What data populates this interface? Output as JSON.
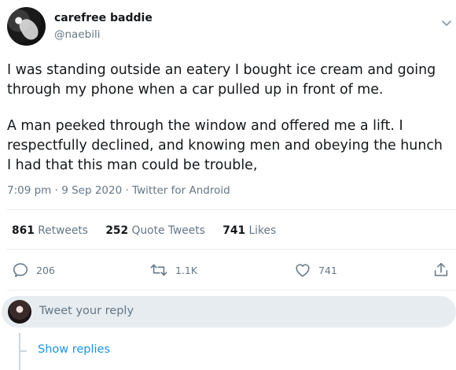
{
  "author": {
    "display_name": "carefree baddie",
    "handle": "@naebili"
  },
  "tweet": {
    "paragraphs": [
      "I was standing outside an eatery I bought ice cream and going through my phone when a car pulled up in front of me.",
      "A man peeked through the window and offered me a lift. I respectfully declined, and knowing men and obeying the hunch I had that this man could be trouble,"
    ],
    "time": "7:09 pm",
    "date": "9 Sep 2020",
    "source": "Twitter for Android",
    "separator": "·"
  },
  "stats": {
    "retweets_count": "861",
    "retweets_label": "Retweets",
    "quotes_count": "252",
    "quotes_label": "Quote Tweets",
    "likes_count": "741",
    "likes_label": "Likes"
  },
  "actions": {
    "reply_count": "206",
    "retweet_count": "1.1K",
    "like_count": "741"
  },
  "reply_box": {
    "placeholder": "Tweet your reply"
  },
  "thread": {
    "show_replies_label": "Show replies"
  },
  "colors": {
    "text": "#14171a",
    "secondary": "#657786",
    "link": "#1b95e0",
    "divider": "#e6ecf0"
  },
  "icons": [
    "caret-down-icon",
    "reply-icon",
    "retweet-icon",
    "like-icon",
    "share-icon"
  ]
}
